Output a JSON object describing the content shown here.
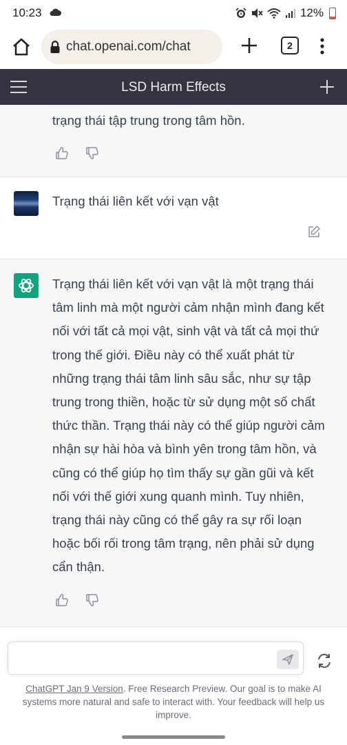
{
  "status": {
    "time": "10:23",
    "battery": "12%"
  },
  "browser": {
    "url": "chat.openai.com/chat",
    "tab_count": "2"
  },
  "header": {
    "title": "LSD Harm Effects"
  },
  "messages": [
    {
      "role": "assistant",
      "text": "trạng thái tập trung trong tâm hồn."
    },
    {
      "role": "user",
      "text": "Trạng thái liên kết với vạn vật"
    },
    {
      "role": "assistant",
      "text": "Trạng thái liên kết với vạn vật là một trạng thái tâm linh mà một người cảm nhận mình đang kết nối với tất cả mọi vật, sinh vật và tất cả mọi thứ trong thế giới. Điều này có thể xuất phát từ những trạng thái tâm linh sâu sắc, như sự tập trung trong thiền, hoặc từ sử dụng một số chất thức thần. Trạng thái này có thể giúp người cảm nhận sự hài hòa và bình yên trong tâm hồn, và cũng có thể giúp họ tìm thấy sự gần gũi và kết nối với thế giới xung quanh mình. Tuy nhiên, trạng thái này cũng có thể gây ra sự rối loạn hoặc bối rối trong tâm trạng, nên phải sử dụng cẩn thận."
    }
  ],
  "input": {
    "value": ""
  },
  "footer": {
    "link": "ChatGPT Jan 9 Version",
    "text": ". Free Research Preview. Our goal is to make AI systems more natural and safe to interact with. Your feedback will help us improve."
  },
  "icons": {
    "status_left": [
      "cloud-icon"
    ],
    "status_right": [
      "alarm-icon",
      "mute-icon",
      "wifi-icon",
      "signal-icon",
      "battery-icon"
    ],
    "browser": [
      "home-icon",
      "lock-icon",
      "plus-icon",
      "tabs-icon",
      "more-icon"
    ],
    "header": [
      "menu-icon",
      "new-chat-icon"
    ],
    "message": [
      "thumbs-up-icon",
      "thumbs-down-icon",
      "edit-icon",
      "openai-logo-icon",
      "user-avatar"
    ],
    "composer": [
      "send-icon",
      "regenerate-icon"
    ]
  },
  "colors": {
    "header_bg": "#343541",
    "assistant_bg": "#f7f7f8",
    "accent": "#10a37f",
    "url_pill": "#f5efe9"
  }
}
